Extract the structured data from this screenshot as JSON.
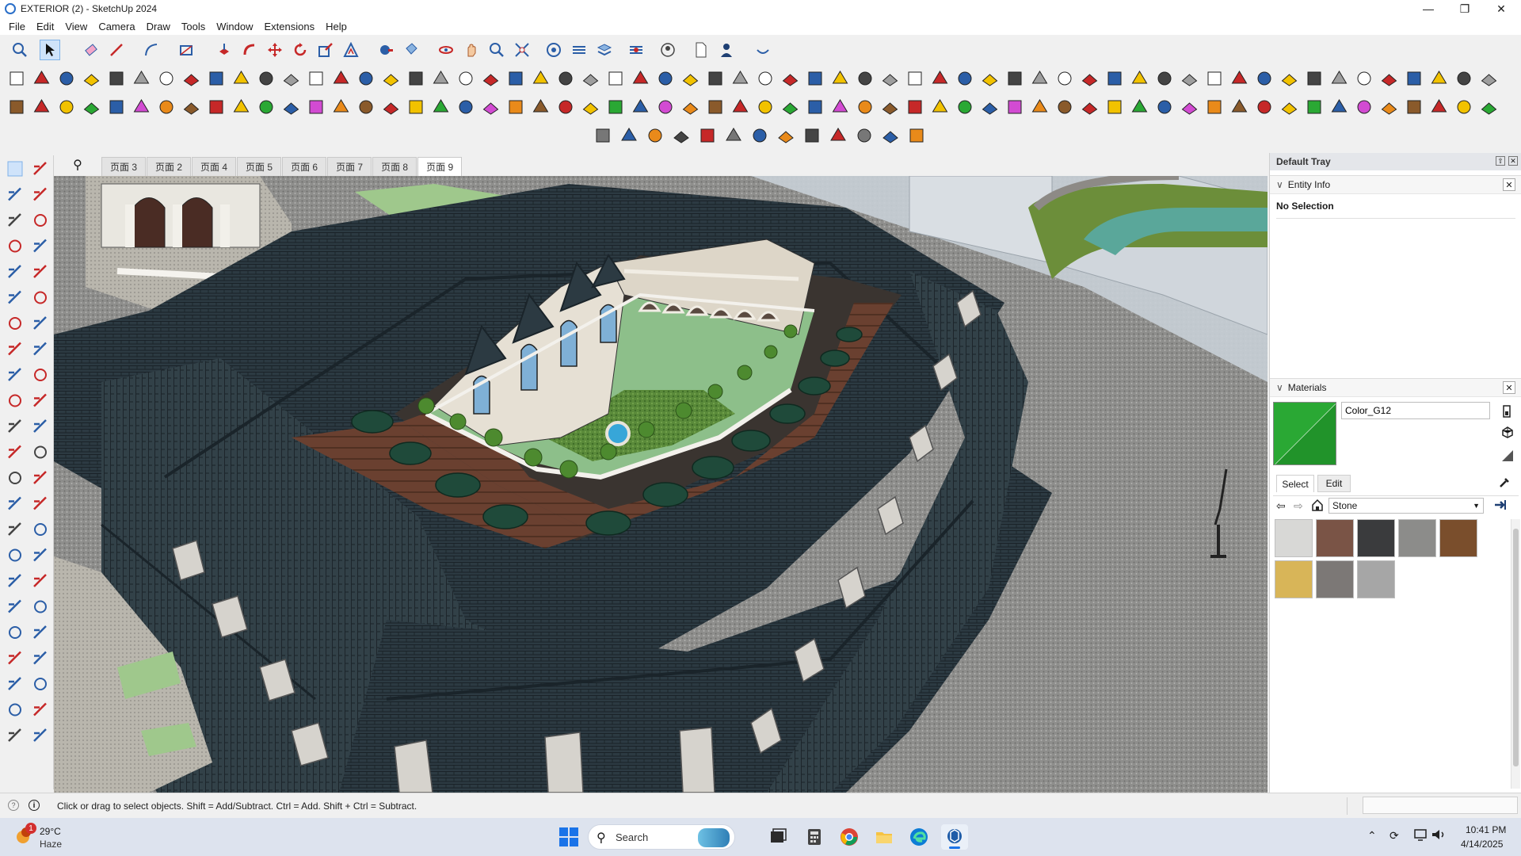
{
  "window": {
    "title": "EXTERIOR  (2) - SketchUp 2024"
  },
  "menu": [
    "File",
    "Edit",
    "View",
    "Camera",
    "Draw",
    "Tools",
    "Window",
    "Extensions",
    "Help"
  ],
  "tabs": [
    "页面 3",
    "页面 2",
    "页面 4",
    "页面 5",
    "页面 6",
    "页面 7",
    "页面 8",
    "页面 9"
  ],
  "active_tab": "页面 9",
  "tray": {
    "title": "Default Tray",
    "entity_info": {
      "label": "Entity Info",
      "selection": "No Selection"
    },
    "materials": {
      "label": "Materials",
      "current_name": "Color_G12",
      "current_color": "#2aa834",
      "tab_select": "Select",
      "tab_edit": "Edit",
      "library": "Stone",
      "swatches": [
        "#d8d8d6",
        "#7a5446",
        "#3a3b3d",
        "#8c8c8a",
        "#7a4e2c",
        "#d8b558",
        "#7c7876",
        "#a6a6a6"
      ]
    }
  },
  "status": {
    "hint": "Click or drag to select objects. Shift = Add/Subtract. Ctrl = Add. Shift + Ctrl = Subtract."
  },
  "taskbar": {
    "weather_temp": "29°C",
    "weather_desc": "Haze",
    "weather_badge": "1",
    "search_placeholder": "Search",
    "time": "10:41 PM",
    "date": "4/14/2025"
  }
}
